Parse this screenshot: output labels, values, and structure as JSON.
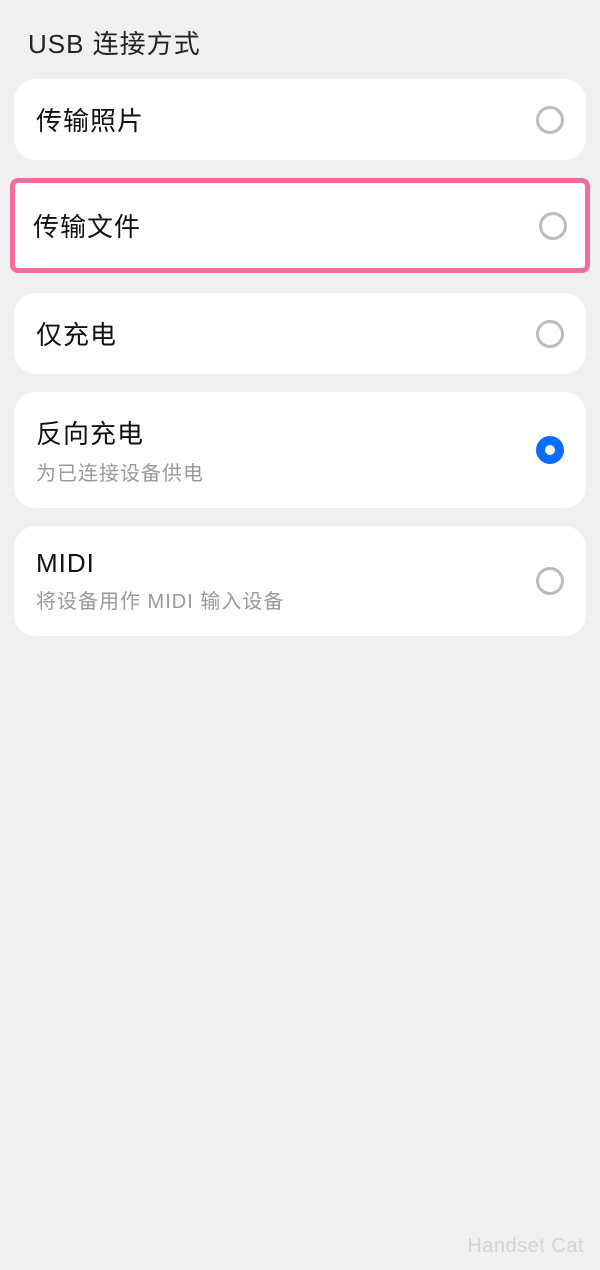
{
  "title": "USB 连接方式",
  "options": [
    {
      "label": "传输照片",
      "sub": "",
      "selected": false,
      "highlight": false
    },
    {
      "label": "传输文件",
      "sub": "",
      "selected": false,
      "highlight": true
    },
    {
      "label": "仅充电",
      "sub": "",
      "selected": false,
      "highlight": false
    },
    {
      "label": "反向充电",
      "sub": "为已连接设备供电",
      "selected": true,
      "highlight": false
    },
    {
      "label": "MIDI",
      "sub": "将设备用作 MIDI 输入设备",
      "selected": false,
      "highlight": false
    }
  ],
  "watermark": "Handset Cat"
}
